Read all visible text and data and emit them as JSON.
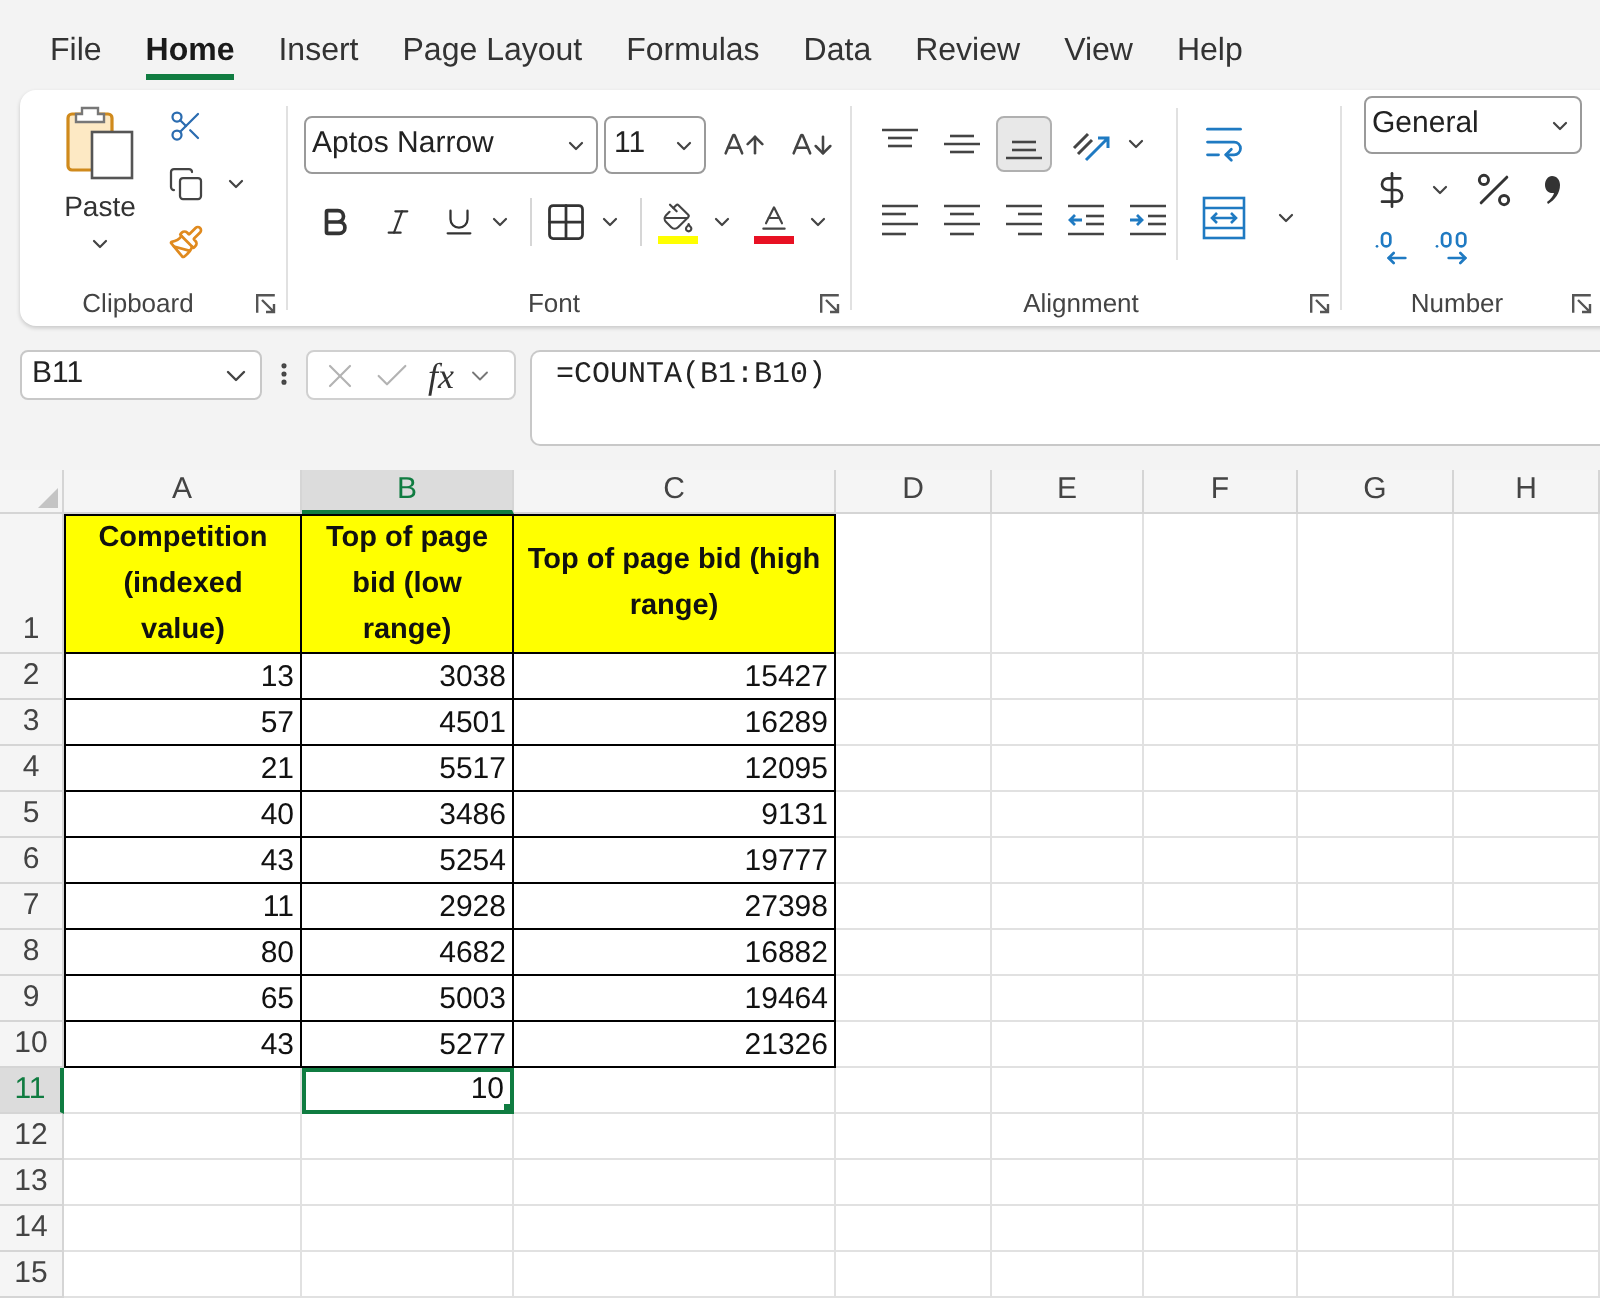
{
  "menu_tabs": [
    {
      "label": "File",
      "selected": false
    },
    {
      "label": "Home",
      "selected": true
    },
    {
      "label": "Insert",
      "selected": false
    },
    {
      "label": "Page Layout",
      "selected": false
    },
    {
      "label": "Formulas",
      "selected": false
    },
    {
      "label": "Data",
      "selected": false
    },
    {
      "label": "Review",
      "selected": false
    },
    {
      "label": "View",
      "selected": false
    },
    {
      "label": "Help",
      "selected": false
    }
  ],
  "ribbon": {
    "clipboard": {
      "paste_label": "Paste",
      "group_label": "Clipboard"
    },
    "font": {
      "font_name": "Aptos Narrow",
      "font_size": "11",
      "group_label": "Font"
    },
    "alignment": {
      "vertical_buttons": [
        {
          "kind": "top",
          "selected": false
        },
        {
          "kind": "middle",
          "selected": false
        },
        {
          "kind": "bottom",
          "selected": true
        }
      ],
      "group_label": "Alignment"
    },
    "number": {
      "format": "General",
      "group_label": "Number"
    }
  },
  "formula_bar": {
    "name_box": "B11",
    "function_label": "fx",
    "formula": "=COUNTA(B1:B10)"
  },
  "sheet": {
    "columns": [
      {
        "label": "A",
        "selected": false
      },
      {
        "label": "B",
        "selected": true
      },
      {
        "label": "C",
        "selected": false
      },
      {
        "label": "D",
        "selected": false
      },
      {
        "label": "E",
        "selected": false
      },
      {
        "label": "F",
        "selected": false
      },
      {
        "label": "G",
        "selected": false
      },
      {
        "label": "H",
        "selected": false
      }
    ],
    "rows": [
      {
        "label": "1",
        "selected": false,
        "cells": [
          {
            "kind": "header",
            "value": "Competition (indexed value)",
            "selected": false
          },
          {
            "kind": "header",
            "value": "Top of page bid (low range)",
            "selected": false
          },
          {
            "kind": "header",
            "value": "Top of page bid (high range)",
            "selected": false
          }
        ]
      },
      {
        "label": "2",
        "selected": false,
        "cells": [
          {
            "kind": "number",
            "value": "13",
            "selected": false
          },
          {
            "kind": "number",
            "value": "3038",
            "selected": false
          },
          {
            "kind": "number",
            "value": "15427",
            "selected": false
          }
        ]
      },
      {
        "label": "3",
        "selected": false,
        "cells": [
          {
            "kind": "number",
            "value": "57",
            "selected": false
          },
          {
            "kind": "number",
            "value": "4501",
            "selected": false
          },
          {
            "kind": "number",
            "value": "16289",
            "selected": false
          }
        ]
      },
      {
        "label": "4",
        "selected": false,
        "cells": [
          {
            "kind": "number",
            "value": "21",
            "selected": false
          },
          {
            "kind": "number",
            "value": "5517",
            "selected": false
          },
          {
            "kind": "number",
            "value": "12095",
            "selected": false
          }
        ]
      },
      {
        "label": "5",
        "selected": false,
        "cells": [
          {
            "kind": "number",
            "value": "40",
            "selected": false
          },
          {
            "kind": "number",
            "value": "3486",
            "selected": false
          },
          {
            "kind": "number",
            "value": "9131",
            "selected": false
          }
        ]
      },
      {
        "label": "6",
        "selected": false,
        "cells": [
          {
            "kind": "number",
            "value": "43",
            "selected": false
          },
          {
            "kind": "number",
            "value": "5254",
            "selected": false
          },
          {
            "kind": "number",
            "value": "19777",
            "selected": false
          }
        ]
      },
      {
        "label": "7",
        "selected": false,
        "cells": [
          {
            "kind": "number",
            "value": "11",
            "selected": false
          },
          {
            "kind": "number",
            "value": "2928",
            "selected": false
          },
          {
            "kind": "number",
            "value": "27398",
            "selected": false
          }
        ]
      },
      {
        "label": "8",
        "selected": false,
        "cells": [
          {
            "kind": "number",
            "value": "80",
            "selected": false
          },
          {
            "kind": "number",
            "value": "4682",
            "selected": false
          },
          {
            "kind": "number",
            "value": "16882",
            "selected": false
          }
        ]
      },
      {
        "label": "9",
        "selected": false,
        "cells": [
          {
            "kind": "number",
            "value": "65",
            "selected": false
          },
          {
            "kind": "number",
            "value": "5003",
            "selected": false
          },
          {
            "kind": "number",
            "value": "19464",
            "selected": false
          }
        ]
      },
      {
        "label": "10",
        "selected": false,
        "cells": [
          {
            "kind": "number",
            "value": "43",
            "selected": false
          },
          {
            "kind": "number",
            "value": "5277",
            "selected": false
          },
          {
            "kind": "number",
            "value": "21326",
            "selected": false
          }
        ]
      },
      {
        "label": "11",
        "selected": true,
        "cells": [
          null,
          {
            "kind": "plain",
            "value": "10",
            "selected": true
          }
        ]
      },
      {
        "label": "12",
        "selected": false
      },
      {
        "label": "13",
        "selected": false
      },
      {
        "label": "14",
        "selected": false
      },
      {
        "label": "15",
        "selected": false
      }
    ]
  }
}
